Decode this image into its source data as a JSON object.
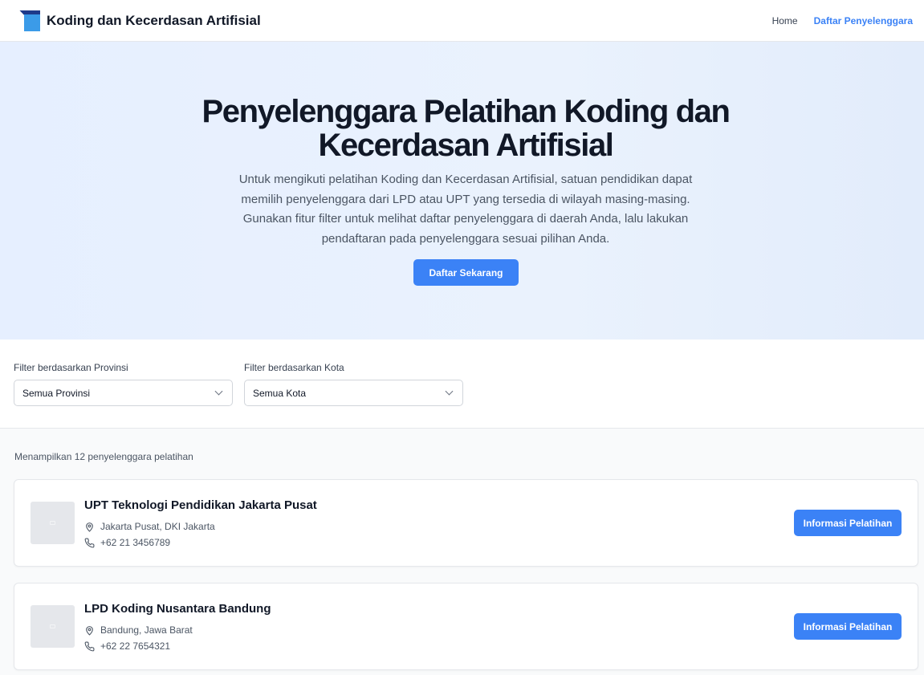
{
  "header": {
    "brand": "Koding dan Kecerdasan Artifisial",
    "nav": [
      {
        "label": "Home"
      },
      {
        "label": "Daftar Penyelenggara"
      }
    ]
  },
  "hero": {
    "title_line1": "Penyelenggara Pelatihan Koding dan",
    "title_line2": "Kecerdasan Artifisial",
    "description": "Untuk mengikuti pelatihan Koding dan Kecerdasan Artifisial, satuan pendidikan dapat memilih penyelenggara dari LPD atau UPT yang tersedia di wilayah masing-masing. Gunakan fitur filter untuk melihat daftar penyelenggara di daerah Anda, lalu lakukan pendaftaran pada penyelenggara sesuai pilihan Anda.",
    "cta_label": "Daftar Sekarang"
  },
  "filters": {
    "province": {
      "label": "Filter berdasarkan Provinsi",
      "value": "Semua Provinsi"
    },
    "city": {
      "label": "Filter berdasarkan Kota",
      "value": "Semua Kota"
    }
  },
  "results": {
    "count_text": "Menampilkan 12 penyelenggara pelatihan",
    "providers": [
      {
        "name": "UPT Teknologi Pendidikan Jakarta Pusat",
        "location": "Jakarta Pusat, DKI Jakarta",
        "phone": "+62 21 3456789",
        "button": "Informasi Pelatihan"
      },
      {
        "name": "LPD Koding Nusantara Bandung",
        "location": "Bandung, Jawa Barat",
        "phone": "+62 22 7654321",
        "button": "Informasi Pelatihan"
      }
    ]
  },
  "colors": {
    "accent": "#3b82f6",
    "logo_dark": "#1e3a8a",
    "logo_light": "#3b9be8"
  }
}
